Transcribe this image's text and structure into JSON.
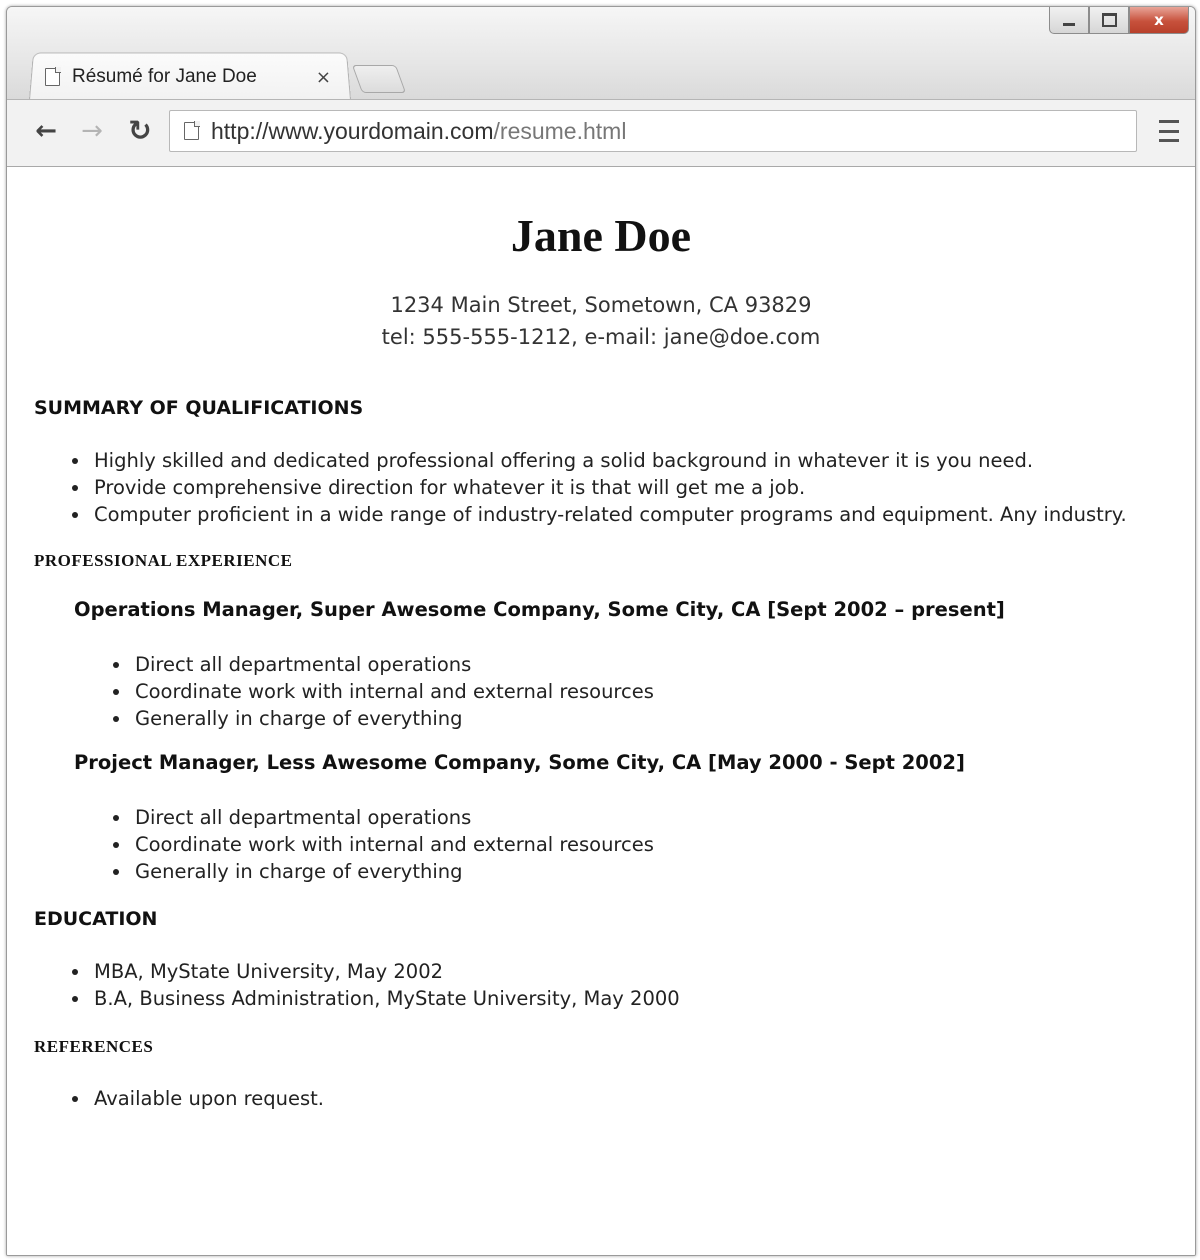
{
  "browser": {
    "tab_title": "Résumé for Jane Doe",
    "tab_close": "×",
    "url_host": "http://www.yourdomain.com",
    "url_path": "/resume.html",
    "close_glyph": "x"
  },
  "resume": {
    "name": "Jane Doe",
    "address": "1234 Main Street, Sometown, CA 93829",
    "contact_line": "tel: 555-555-1212, e-mail: jane@doe.com",
    "summary_heading": "SUMMARY OF QUALIFICATIONS",
    "summary_items": [
      "Highly skilled and dedicated professional offering a solid background in whatever it is you need.",
      "Provide comprehensive direction for whatever it is that will get me a job.",
      "Computer proficient in a wide range of industry-related computer programs and equipment. Any industry."
    ],
    "experience_heading": "PROFESSIONAL EXPERIENCE",
    "jobs": [
      {
        "title": "Operations Manager, Super Awesome Company, Some City, CA [Sept 2002 – present]",
        "duties": [
          "Direct all departmental operations",
          "Coordinate work with internal and external resources",
          "Generally in charge of everything"
        ]
      },
      {
        "title": "Project Manager, Less Awesome Company, Some City, CA [May 2000 - Sept 2002]",
        "duties": [
          "Direct all departmental operations",
          "Coordinate work with internal and external resources",
          "Generally in charge of everything"
        ]
      }
    ],
    "education_heading": "EDUCATION",
    "education_items": [
      "MBA, MyState University, May 2002",
      "B.A, Business Administration, MyState University, May 2000"
    ],
    "references_heading": "REFERENCES",
    "references_items": [
      "Available upon request."
    ]
  }
}
